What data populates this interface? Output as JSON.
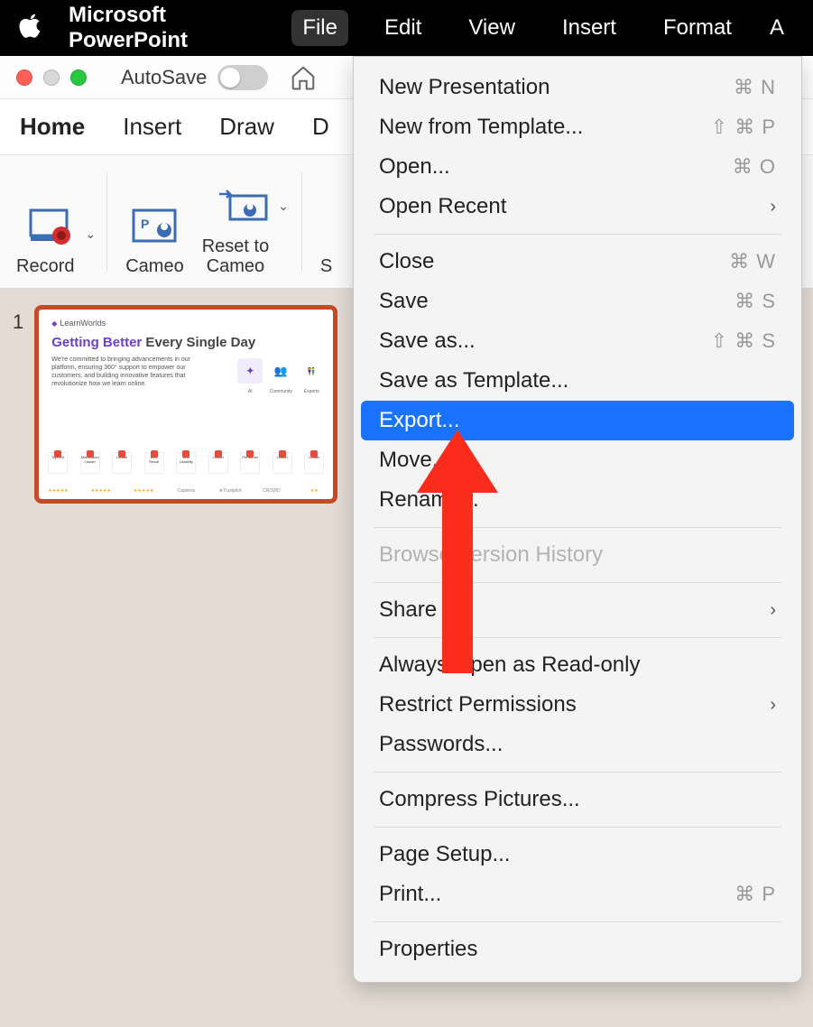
{
  "menubar": {
    "app_name": "Microsoft PowerPoint",
    "items": [
      "File",
      "Edit",
      "View",
      "Insert",
      "Format"
    ],
    "active_index": 0,
    "truncated_last": "A"
  },
  "titlebar": {
    "autosave_label": "AutoSave"
  },
  "ribbon_tabs": [
    "Home",
    "Insert",
    "Draw",
    "D"
  ],
  "ribbon": {
    "record": "Record",
    "cameo": "Cameo",
    "reset_to_cameo_l1": "Reset to",
    "reset_to_cameo_l2": "Cameo",
    "partial": "S"
  },
  "slide": {
    "number": "1",
    "brand": "LearnWorlds",
    "title_purple": "Getting Better",
    "title_rest": " Every Single Day",
    "body": "We're committed to bringing advancements in our platform, ensuring 360° support to empower our customers, and building innovative features that revolutionize how we learn online.",
    "mini_labels": [
      "AI",
      "Community",
      "Experts"
    ],
    "badges": [
      "Top 100",
      "Momentum Leader",
      "Leader",
      "Best Result",
      "Best Usability",
      "Leader",
      "Performer",
      "Leader",
      "Leader"
    ],
    "ratings": [
      "★★★★★",
      "★★★★★",
      "★★★★★",
      "Capterra",
      "★Trustpilot",
      "CROWD",
      "★★"
    ]
  },
  "menu": {
    "groups": [
      [
        {
          "label": "New Presentation",
          "shortcut": "⌘ N"
        },
        {
          "label": "New from Template...",
          "shortcut": "⇧ ⌘ P"
        },
        {
          "label": "Open...",
          "shortcut": "⌘ O"
        },
        {
          "label": "Open Recent",
          "submenu": true
        }
      ],
      [
        {
          "label": "Close",
          "shortcut": "⌘ W"
        },
        {
          "label": "Save",
          "shortcut": "⌘ S"
        },
        {
          "label": "Save as...",
          "shortcut": "⇧ ⌘ S"
        },
        {
          "label": "Save as Template..."
        },
        {
          "label": "Export...",
          "highlight": true
        },
        {
          "label": "Move..."
        },
        {
          "label": "Rename..."
        }
      ],
      [
        {
          "label": "Browse Version History",
          "disabled": true
        }
      ],
      [
        {
          "label": "Share",
          "submenu": true
        }
      ],
      [
        {
          "label": "Always Open as Read-only"
        },
        {
          "label": "Restrict Permissions",
          "submenu": true
        },
        {
          "label": "Passwords..."
        }
      ],
      [
        {
          "label": "Compress Pictures..."
        }
      ],
      [
        {
          "label": "Page Setup..."
        },
        {
          "label": "Print...",
          "shortcut": "⌘ P"
        }
      ],
      [
        {
          "label": "Properties"
        }
      ]
    ]
  }
}
